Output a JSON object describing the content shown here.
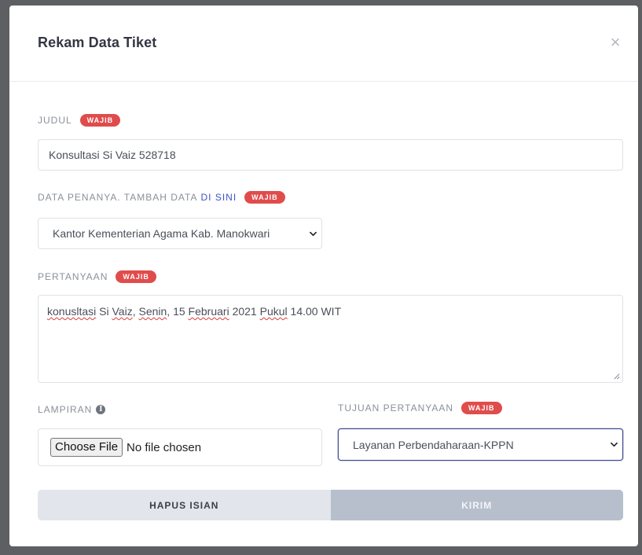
{
  "modal": {
    "title": "Rekam Data Tiket",
    "close_symbol": "×"
  },
  "fields": {
    "judul": {
      "label": "JUDUL",
      "badge": "WAJIB",
      "value": "Konsultasi Si Vaiz 528718"
    },
    "penanya": {
      "label": "DATA PENANYA. TAMBAH DATA",
      "link": "DI SINI",
      "badge": "WAJIB",
      "selected": "Kantor Kementerian Agama Kab. Manokwari"
    },
    "pertanyaan": {
      "label": "PERTANYAAN",
      "badge": "WAJIB",
      "value_parts": [
        "konusltasi",
        " Si ",
        "Vaiz",
        ", ",
        "Senin",
        ", 15 ",
        "Februari",
        " 2021 ",
        "Pukul",
        " 14.00 WIT"
      ]
    },
    "lampiran": {
      "label": "LAMPIRAN",
      "icon": "info-icon",
      "button_label": "Choose File",
      "status": "No file chosen"
    },
    "tujuan": {
      "label": "TUJUAN PERTANYAAN",
      "badge": "WAJIB",
      "selected": "Layanan Perbendaharaan-KPPN"
    }
  },
  "actions": {
    "reset_label": "HAPUS ISIAN",
    "submit_label": "KIRIM"
  },
  "colors": {
    "badge": "#e04c4c",
    "link": "#3a55c4",
    "focus_border": "#3c4a8f",
    "reset_bg": "#e2e5eb",
    "submit_bg": "#b7bfcd"
  }
}
